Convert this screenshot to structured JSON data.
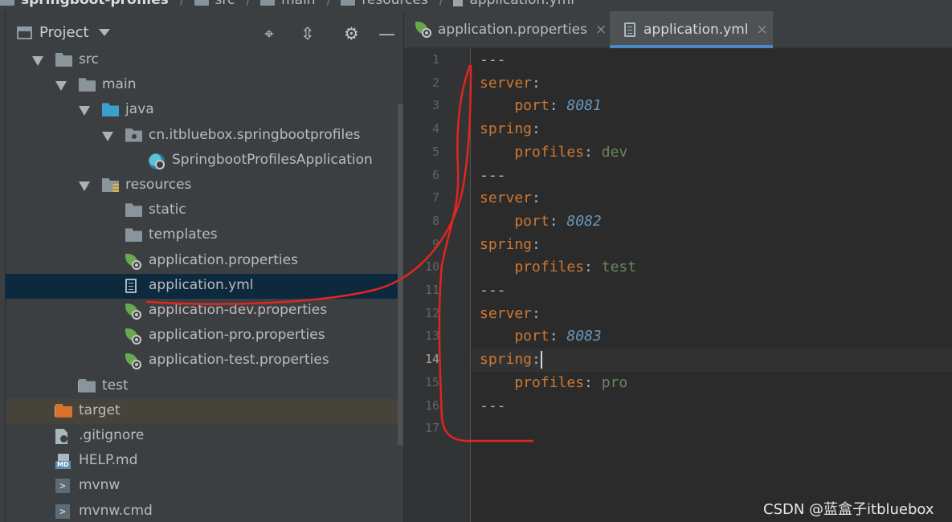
{
  "breadcrumb": {
    "items": [
      "springboot-profiles",
      "src",
      "main",
      "resources",
      "application.yml"
    ]
  },
  "project_panel": {
    "title": "Project",
    "toolbar": {
      "locate": "⌖",
      "collapse": "⇳",
      "settings": "⚙",
      "hide": "—"
    },
    "tree": [
      {
        "label": "src",
        "depth": 1,
        "icon": "folder-icon",
        "state": "expanded"
      },
      {
        "label": "main",
        "depth": 2,
        "icon": "folder-icon",
        "state": "expanded"
      },
      {
        "label": "java",
        "depth": 3,
        "icon": "source-folder-icon",
        "state": "expanded"
      },
      {
        "label": "cn.itbluebox.springbootprofiles",
        "depth": 4,
        "icon": "package-icon",
        "state": "expanded"
      },
      {
        "label": "SpringbootProfilesApplication",
        "depth": 5,
        "icon": "spring-app-icon",
        "state": "leaf"
      },
      {
        "label": "resources",
        "depth": 3,
        "icon": "resources-folder-icon",
        "state": "expanded"
      },
      {
        "label": "static",
        "depth": 4,
        "icon": "folder-icon",
        "state": "leaf"
      },
      {
        "label": "templates",
        "depth": 4,
        "icon": "folder-icon",
        "state": "leaf"
      },
      {
        "label": "application.properties",
        "depth": 4,
        "icon": "spring-properties-icon",
        "state": "leaf"
      },
      {
        "label": "application.yml",
        "depth": 4,
        "icon": "yaml-file-icon",
        "state": "selected"
      },
      {
        "label": "application-dev.properties",
        "depth": 4,
        "icon": "spring-properties-icon",
        "state": "leaf"
      },
      {
        "label": "application-pro.properties",
        "depth": 4,
        "icon": "spring-properties-icon",
        "state": "leaf"
      },
      {
        "label": "application-test.properties",
        "depth": 4,
        "icon": "spring-properties-icon",
        "state": "leaf"
      },
      {
        "label": "test",
        "depth": 2,
        "icon": "folder-icon",
        "state": "collapsed"
      },
      {
        "label": "target",
        "depth": 1,
        "icon": "excluded-folder-icon",
        "state": "collapsed"
      },
      {
        "label": ".gitignore",
        "depth": 1,
        "icon": "gitignore-file-icon",
        "state": "leaf"
      },
      {
        "label": "HELP.md",
        "depth": 1,
        "icon": "markdown-file-icon",
        "state": "leaf"
      },
      {
        "label": "mvnw",
        "depth": 1,
        "icon": "shell-script-icon",
        "state": "leaf"
      },
      {
        "label": "mvnw.cmd",
        "depth": 1,
        "icon": "shell-script-icon",
        "state": "leaf"
      }
    ]
  },
  "editor": {
    "tabs": [
      {
        "label": "application.properties",
        "active": false,
        "close": "×"
      },
      {
        "label": "application.yml",
        "active": true,
        "close": "×"
      }
    ],
    "current_line": 14,
    "lines": [
      {
        "num": "1",
        "parts": [
          {
            "t": "---",
            "c": "plain"
          }
        ]
      },
      {
        "num": "2",
        "parts": [
          {
            "t": "server",
            "c": "key"
          },
          {
            "t": ":",
            "c": "plain"
          }
        ]
      },
      {
        "num": "3",
        "parts": [
          {
            "t": "    port",
            "c": "key"
          },
          {
            "t": ": ",
            "c": "plain"
          },
          {
            "t": "8081",
            "c": "num"
          }
        ]
      },
      {
        "num": "4",
        "parts": [
          {
            "t": "spring",
            "c": "key"
          },
          {
            "t": ":",
            "c": "plain"
          }
        ]
      },
      {
        "num": "5",
        "parts": [
          {
            "t": "    profiles",
            "c": "key"
          },
          {
            "t": ": ",
            "c": "plain"
          },
          {
            "t": "dev",
            "c": "str"
          }
        ]
      },
      {
        "num": "6",
        "parts": [
          {
            "t": "---",
            "c": "plain"
          }
        ]
      },
      {
        "num": "7",
        "parts": [
          {
            "t": "server",
            "c": "key"
          },
          {
            "t": ":",
            "c": "plain"
          }
        ]
      },
      {
        "num": "8",
        "parts": [
          {
            "t": "    port",
            "c": "key"
          },
          {
            "t": ": ",
            "c": "plain"
          },
          {
            "t": "8082",
            "c": "num"
          }
        ]
      },
      {
        "num": "9",
        "parts": [
          {
            "t": "spring",
            "c": "key"
          },
          {
            "t": ":",
            "c": "plain"
          }
        ]
      },
      {
        "num": "10",
        "parts": [
          {
            "t": "    profiles",
            "c": "key"
          },
          {
            "t": ": ",
            "c": "plain"
          },
          {
            "t": "test",
            "c": "str"
          }
        ]
      },
      {
        "num": "11",
        "parts": [
          {
            "t": "---",
            "c": "plain"
          }
        ]
      },
      {
        "num": "12",
        "parts": [
          {
            "t": "server",
            "c": "key"
          },
          {
            "t": ":",
            "c": "plain"
          }
        ]
      },
      {
        "num": "13",
        "parts": [
          {
            "t": "    port",
            "c": "key"
          },
          {
            "t": ": ",
            "c": "plain"
          },
          {
            "t": "8083",
            "c": "num"
          }
        ]
      },
      {
        "num": "14",
        "parts": [
          {
            "t": "spring",
            "c": "key"
          },
          {
            "t": ":",
            "c": "plain"
          }
        ]
      },
      {
        "num": "15",
        "parts": [
          {
            "t": "    profiles",
            "c": "key"
          },
          {
            "t": ": ",
            "c": "plain"
          },
          {
            "t": "pro",
            "c": "str"
          }
        ]
      },
      {
        "num": "16",
        "parts": [
          {
            "t": "---",
            "c": "plain"
          }
        ]
      },
      {
        "num": "17",
        "parts": []
      }
    ]
  },
  "watermark": "CSDN @蓝盒子itbluebox",
  "colors": {
    "selection": "#0d293e",
    "annotation_stroke": "#e0261f",
    "yaml_key": "#cc7832",
    "yaml_number": "#6897bb",
    "yaml_string": "#6a8759"
  }
}
